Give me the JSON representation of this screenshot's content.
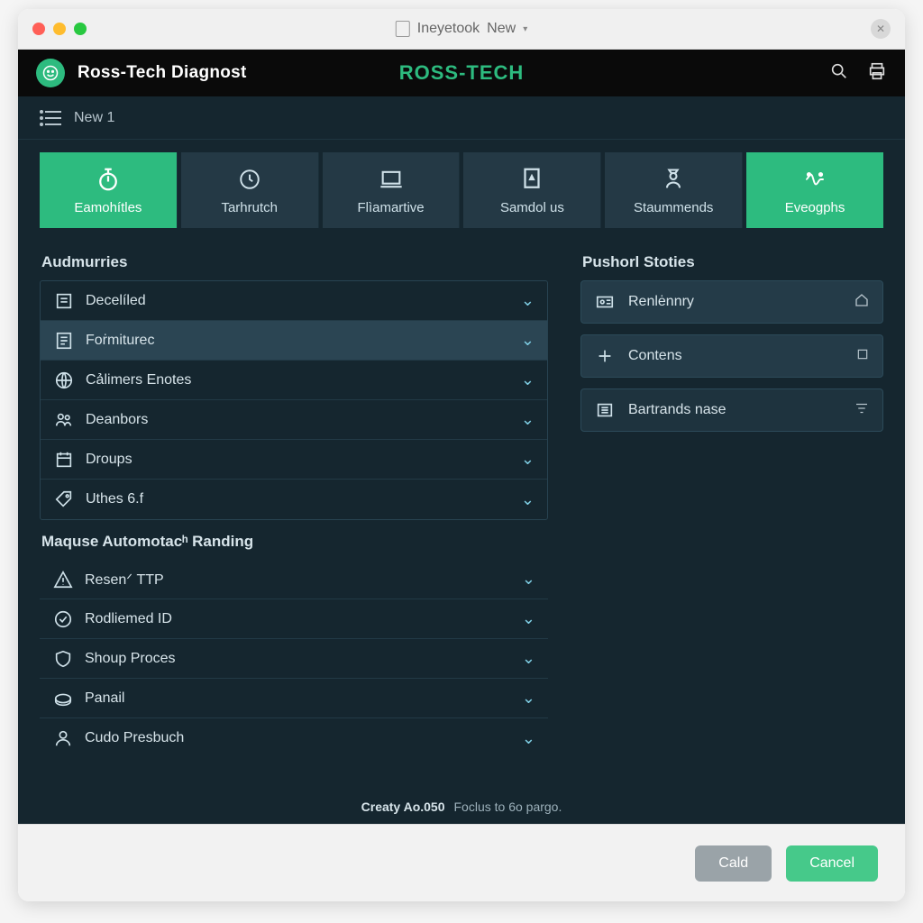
{
  "titlebar": {
    "title": "Ineyetook",
    "new_label": "New"
  },
  "header": {
    "app_title": "Ross-Tech Diagnost",
    "brand": "ROSS-TECH"
  },
  "subbar": {
    "label": "New 1"
  },
  "tabs": [
    {
      "label": "Eamohítles",
      "active": true
    },
    {
      "label": "Tarhrutch"
    },
    {
      "label": "Flìamartive"
    },
    {
      "label": "Samdol us"
    },
    {
      "label": "Staummends"
    },
    {
      "label": "Eveogphs",
      "right_active": true
    }
  ],
  "left_sections": [
    {
      "title": "Audmurries",
      "rows": [
        {
          "icon": "doc-list-icon",
          "label": "Decelíled"
        },
        {
          "icon": "form-icon",
          "label": "Foṙmiturec",
          "highlight": true
        },
        {
          "icon": "globe-icon",
          "label": "Cảlimers Enotes"
        },
        {
          "icon": "people-icon",
          "label": "Deanbors"
        },
        {
          "icon": "calendar-icon",
          "label": "Droups"
        },
        {
          "icon": "tag-icon",
          "label": "Uthes 6.f"
        }
      ]
    },
    {
      "title": "Maquse Automotacʰ Randing",
      "rows": [
        {
          "icon": "warning-icon",
          "label": "Resenᐟ TTP"
        },
        {
          "icon": "check-circle-icon",
          "label": "Rodliemed ID"
        },
        {
          "icon": "shield-icon",
          "label": "Shoup Proces"
        },
        {
          "icon": "disk-icon",
          "label": "Panail"
        },
        {
          "icon": "person-icon",
          "label": "Cudo Presbuch"
        }
      ]
    }
  ],
  "right_section": {
    "title": "Pushorl Stoties",
    "cards": [
      {
        "icon": "id-icon",
        "label": "Renlėnnry",
        "tail": "home-icon"
      },
      {
        "icon": "plus-icon",
        "label": "Contens",
        "tail": "square-icon"
      },
      {
        "icon": "list-icon",
        "label": "Bartrands nase",
        "tail": "filter-icon"
      }
    ]
  },
  "status": {
    "strong": "Creaty Ao.050",
    "text": "Foclus to 6o pargo."
  },
  "buttons": {
    "secondary": "Cald",
    "primary": "Cancel"
  }
}
